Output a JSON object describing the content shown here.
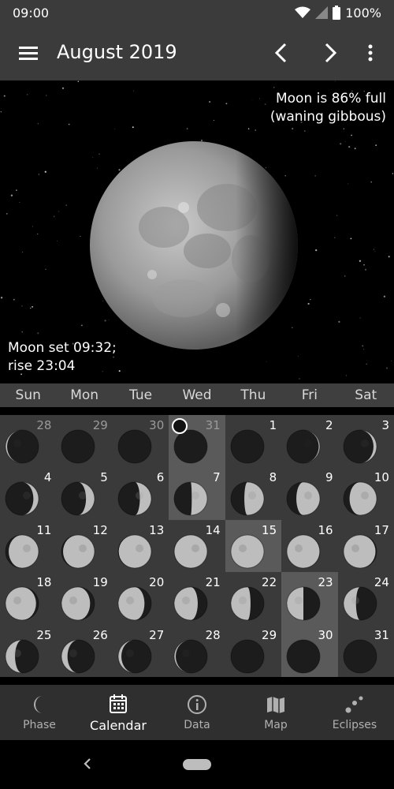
{
  "status_bar": {
    "time": "09:00",
    "battery": "100%"
  },
  "app_bar": {
    "title": "August 2019"
  },
  "moon": {
    "illumination_line1": "Moon is 86% full",
    "illumination_line2": "(waning gibbous)",
    "set_line1": "Moon set 09:32;",
    "set_line2": "rise 23:04"
  },
  "weekdays": [
    "Sun",
    "Mon",
    "Tue",
    "Wed",
    "Thu",
    "Fri",
    "Sat"
  ],
  "calendar": {
    "days": [
      {
        "day": "28",
        "other": true,
        "highlight": false,
        "phase": 0.93
      },
      {
        "day": "29",
        "other": true,
        "highlight": false,
        "phase": 0.96
      },
      {
        "day": "30",
        "other": true,
        "highlight": false,
        "phase": 0.99
      },
      {
        "day": "31",
        "other": true,
        "highlight": true,
        "phase": 0.02,
        "today": true
      },
      {
        "day": "1",
        "other": false,
        "highlight": false,
        "phase": 0.03
      },
      {
        "day": "2",
        "other": false,
        "highlight": false,
        "phase": 0.06
      },
      {
        "day": "3",
        "other": false,
        "highlight": false,
        "phase": 0.1
      },
      {
        "day": "4",
        "other": false,
        "highlight": false,
        "phase": 0.13
      },
      {
        "day": "5",
        "other": false,
        "highlight": false,
        "phase": 0.17
      },
      {
        "day": "6",
        "other": false,
        "highlight": false,
        "phase": 0.2
      },
      {
        "day": "7",
        "other": false,
        "highlight": true,
        "phase": 0.24
      },
      {
        "day": "8",
        "other": false,
        "highlight": false,
        "phase": 0.28
      },
      {
        "day": "9",
        "other": false,
        "highlight": false,
        "phase": 0.32
      },
      {
        "day": "10",
        "other": false,
        "highlight": false,
        "phase": 0.36
      },
      {
        "day": "11",
        "other": false,
        "highlight": false,
        "phase": 0.4
      },
      {
        "day": "12",
        "other": false,
        "highlight": false,
        "phase": 0.43
      },
      {
        "day": "13",
        "other": false,
        "highlight": false,
        "phase": 0.46
      },
      {
        "day": "14",
        "other": false,
        "highlight": false,
        "phase": 0.48
      },
      {
        "day": "15",
        "other": false,
        "highlight": true,
        "phase": 0.5
      },
      {
        "day": "16",
        "other": false,
        "highlight": false,
        "phase": 0.53
      },
      {
        "day": "17",
        "other": false,
        "highlight": false,
        "phase": 0.56
      },
      {
        "day": "18",
        "other": false,
        "highlight": false,
        "phase": 0.59
      },
      {
        "day": "19",
        "other": false,
        "highlight": false,
        "phase": 0.62
      },
      {
        "day": "20",
        "other": false,
        "highlight": false,
        "phase": 0.65
      },
      {
        "day": "21",
        "other": false,
        "highlight": false,
        "phase": 0.68
      },
      {
        "day": "22",
        "other": false,
        "highlight": false,
        "phase": 0.72
      },
      {
        "day": "23",
        "other": false,
        "highlight": true,
        "phase": 0.75
      },
      {
        "day": "24",
        "other": false,
        "highlight": false,
        "phase": 0.79
      },
      {
        "day": "25",
        "other": false,
        "highlight": false,
        "phase": 0.82
      },
      {
        "day": "26",
        "other": false,
        "highlight": false,
        "phase": 0.86
      },
      {
        "day": "27",
        "other": false,
        "highlight": false,
        "phase": 0.9
      },
      {
        "day": "28",
        "other": false,
        "highlight": false,
        "phase": 0.93
      },
      {
        "day": "29",
        "other": false,
        "highlight": false,
        "phase": 0.96
      },
      {
        "day": "30",
        "other": false,
        "highlight": true,
        "phase": 0.99
      },
      {
        "day": "31",
        "other": false,
        "highlight": false,
        "phase": 0.02
      }
    ]
  },
  "bottom_nav": {
    "items": [
      {
        "label": "Phase",
        "icon": "crescent-icon",
        "active": false
      },
      {
        "label": "Calendar",
        "icon": "calendar-icon",
        "active": true
      },
      {
        "label": "Data",
        "icon": "info-icon",
        "active": false
      },
      {
        "label": "Map",
        "icon": "map-icon",
        "active": false
      },
      {
        "label": "Eclipses",
        "icon": "eclipse-icon",
        "active": false
      }
    ]
  },
  "colors": {
    "app_bar": "#3b3b3b",
    "calendar_bg": "#3a3a3a",
    "highlight": "#5a5a5a",
    "nav_bg": "#2f2f2f"
  }
}
